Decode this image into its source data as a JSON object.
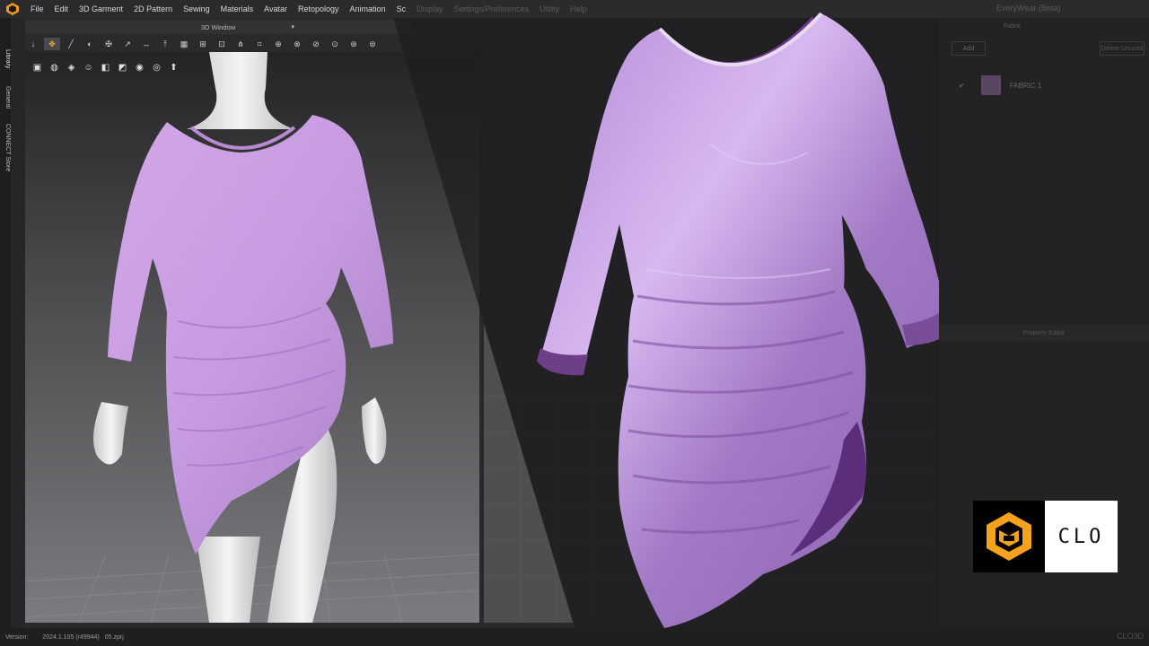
{
  "menubar": {
    "items": [
      "File",
      "Edit",
      "3D Garment",
      "2D Pattern",
      "Sewing",
      "Materials",
      "Avatar",
      "Retopology",
      "Animation",
      "Sc",
      "Display",
      "Settings/Preferences",
      "Utility",
      "Help"
    ],
    "workspace": "EveryWear (Beta)"
  },
  "sidebar": {
    "tabs": [
      "Library",
      "General",
      "CONNECT Store"
    ]
  },
  "window3d": {
    "title": "3D Window"
  },
  "toolbar1": {
    "icons": [
      "↓",
      "✥",
      "╱",
      "◐",
      "✠",
      "↗",
      "↔",
      "⤒",
      "▦",
      "⊞",
      "⊡",
      "⋔",
      "⌗",
      "⊕",
      "⊗",
      "⊘",
      "⊙",
      "⊛",
      "⊜"
    ]
  },
  "toolbar2": {
    "icons": [
      "▣",
      "◍",
      "◈",
      "☺",
      "◧",
      "◩",
      "◉",
      "◎",
      "⬆"
    ]
  },
  "right_panel": {
    "tab": "Fabric",
    "add_label": "Add",
    "button_label": "Delete Unused",
    "fabric_name": "FABRIC 1",
    "section": "Property Editor"
  },
  "statusbar": {
    "version_label": "Version:",
    "version_value": "2024.1.105 (r49944)",
    "file": "05.zprj"
  },
  "logo": {
    "text": "CLO"
  },
  "watermark": "CLO3D"
}
